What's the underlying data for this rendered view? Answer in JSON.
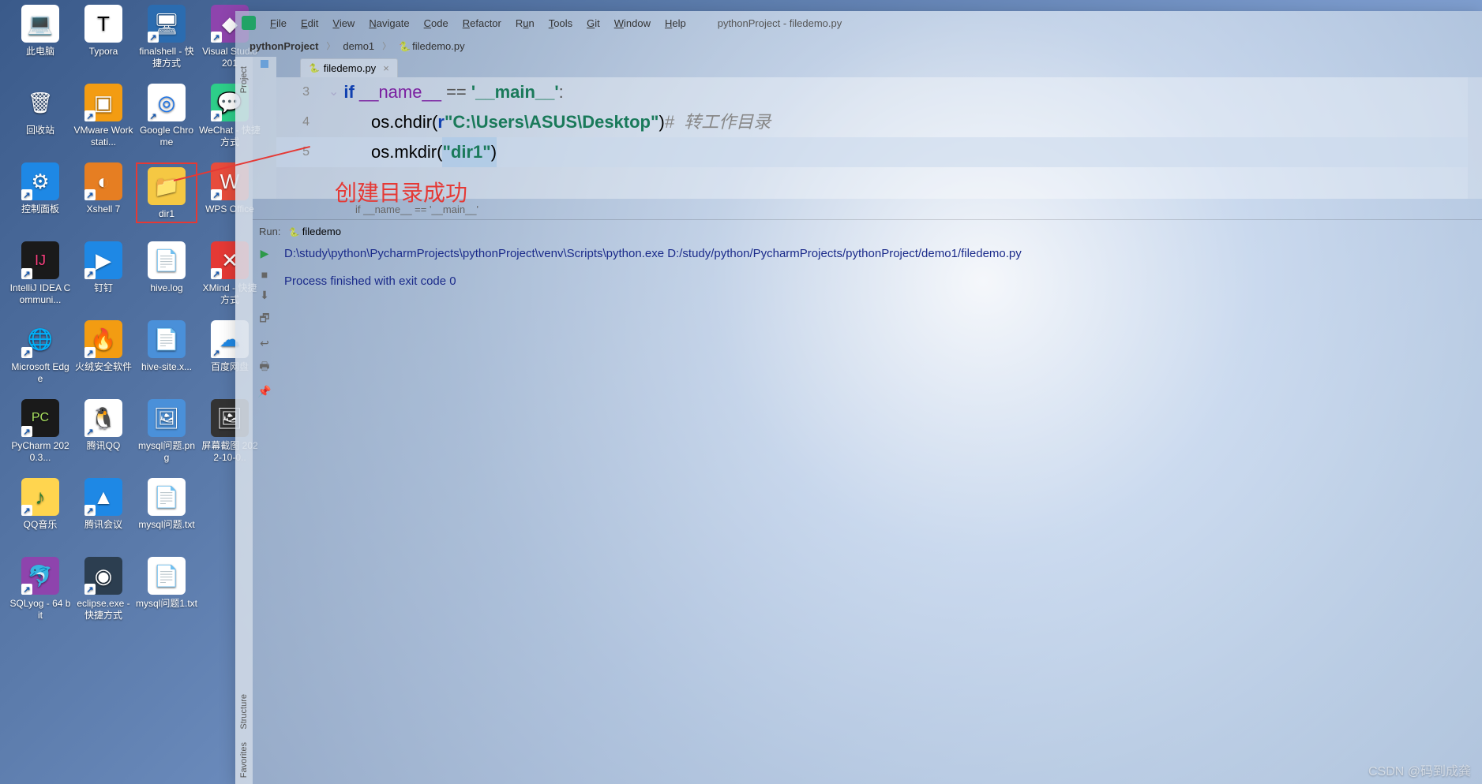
{
  "desktop_icons": [
    {
      "label": "此电脑",
      "bg": "#fff",
      "emoji": "💻",
      "shortcut": false
    },
    {
      "label": "Typora",
      "bg": "#fff",
      "emoji": "T",
      "shortcut": false,
      "txt": "#000"
    },
    {
      "label": "finalshell - 快捷方式",
      "bg": "#2b6cb0",
      "emoji": "🖥",
      "shortcut": true
    },
    {
      "label": "Visual Studio 201",
      "bg": "#8e44ad",
      "emoji": "◆",
      "shortcut": true
    },
    {
      "label": "回收站",
      "bg": "transparent",
      "emoji": "🗑",
      "shortcut": false
    },
    {
      "label": "VMware Workstati...",
      "bg": "#f39c12",
      "emoji": "▣",
      "shortcut": true
    },
    {
      "label": "Google Chrome",
      "bg": "#fff",
      "emoji": "◎",
      "shortcut": true,
      "txt": "#1a73e8"
    },
    {
      "label": "WeChat - 快捷方式",
      "bg": "#2dce89",
      "emoji": "💬",
      "shortcut": true
    },
    {
      "label": "控制面板",
      "bg": "#1e88e5",
      "emoji": "⚙",
      "shortcut": true
    },
    {
      "label": "Xshell 7",
      "bg": "#e67e22",
      "emoji": "◐",
      "shortcut": true
    },
    {
      "label": "dir1",
      "bg": "#f5c843",
      "emoji": "📁",
      "shortcut": false,
      "highlight": true
    },
    {
      "label": "WPS Office",
      "bg": "#e74c3c",
      "emoji": "W",
      "shortcut": true
    },
    {
      "label": "IntelliJ IDEA Communi...",
      "bg": "#1a1a1a",
      "emoji": "IJ",
      "shortcut": true,
      "txt": "#ff4081",
      "fs": "18px"
    },
    {
      "label": "钉钉",
      "bg": "#1e88e5",
      "emoji": "▶",
      "shortcut": true
    },
    {
      "label": "hive.log",
      "bg": "#fff",
      "emoji": "📄",
      "shortcut": false
    },
    {
      "label": "XMind - 快捷方式",
      "bg": "#e53935",
      "emoji": "✕",
      "shortcut": true
    },
    {
      "label": "Microsoft Edge",
      "bg": "transparent",
      "emoji": "🌐",
      "shortcut": true
    },
    {
      "label": "火绒安全软件",
      "bg": "#f39c12",
      "emoji": "🔥",
      "shortcut": true
    },
    {
      "label": "hive-site.x...",
      "bg": "#4a90d9",
      "emoji": "📄",
      "shortcut": false
    },
    {
      "label": "百度网盘",
      "bg": "#fff",
      "emoji": "☁",
      "shortcut": true,
      "txt": "#1e88e5"
    },
    {
      "label": "PyCharm 2020.3...",
      "bg": "#1a1a1a",
      "emoji": "PC",
      "shortcut": true,
      "txt": "#a8e05f",
      "fs": "16px"
    },
    {
      "label": "腾讯QQ",
      "bg": "#fff",
      "emoji": "🐧",
      "shortcut": true
    },
    {
      "label": "mysql问题.png",
      "bg": "#4a90d9",
      "emoji": "🖼",
      "shortcut": false
    },
    {
      "label": "屏幕截图 2022-10-0..",
      "bg": "#333",
      "emoji": "🖼",
      "shortcut": false
    },
    {
      "label": "QQ音乐",
      "bg": "#ffd54f",
      "emoji": "♪",
      "shortcut": true,
      "txt": "#2e7d32"
    },
    {
      "label": "腾讯会议",
      "bg": "#1e88e5",
      "emoji": "▲",
      "shortcut": true
    },
    {
      "label": "mysql问题.txt",
      "bg": "#fff",
      "emoji": "📄",
      "shortcut": false
    },
    {
      "label": "",
      "bg": "",
      "emoji": "",
      "shortcut": false,
      "empty": true
    },
    {
      "label": "SQLyog - 64 bit",
      "bg": "#8e44ad",
      "emoji": "🐬",
      "shortcut": true
    },
    {
      "label": "eclipse.exe - 快捷方式",
      "bg": "#2c3e50",
      "emoji": "◉",
      "shortcut": true
    },
    {
      "label": "mysql问题1.txt",
      "bg": "#fff",
      "emoji": "📄",
      "shortcut": false
    }
  ],
  "menu": {
    "file": "File",
    "edit": "Edit",
    "view": "View",
    "navigate": "Navigate",
    "code": "Code",
    "refactor": "Refactor",
    "run": "Run",
    "tools": "Tools",
    "git": "Git",
    "window": "Window",
    "help": "Help"
  },
  "window_title": "pythonProject - filedemo.py",
  "crumbs": {
    "project": "pythonProject",
    "sep": "〉",
    "pkg": "demo1",
    "file": "filedemo.py"
  },
  "tab": {
    "name": "filedemo.py"
  },
  "code": {
    "l3": {
      "n": "3"
    },
    "l4": {
      "n": "4",
      "os": "os",
      "chdir": ".chdir(",
      "r": "r",
      "path": "\"C:\\Users\\ASUS\\Desktop\"",
      "close": ")",
      "cmt": "#  转工作目录"
    },
    "l5": {
      "n": "5",
      "os": "os",
      "mkdir": ".mkdir(",
      "arg": "\"dir1\"",
      "close": ")"
    },
    "if": "if ",
    "name": "__name__",
    "eq": " == ",
    "main": "'__main__'",
    "colon": ":"
  },
  "crumb_bar": "if __name__ == '__main__'",
  "annotation": "创建目录成功",
  "run": {
    "label": "Run:",
    "target": "filedemo",
    "line1": "D:\\study\\python\\PycharmProjects\\pythonProject\\venv\\Scripts\\python.exe D:/study/python/PycharmProjects/pythonProject/demo1/filedemo.py",
    "line2": "Process finished with exit code 0"
  },
  "rails": {
    "project": "Project",
    "structure": "Structure",
    "favorites": "Favorites"
  },
  "watermark": "CSDN @码到成龚"
}
